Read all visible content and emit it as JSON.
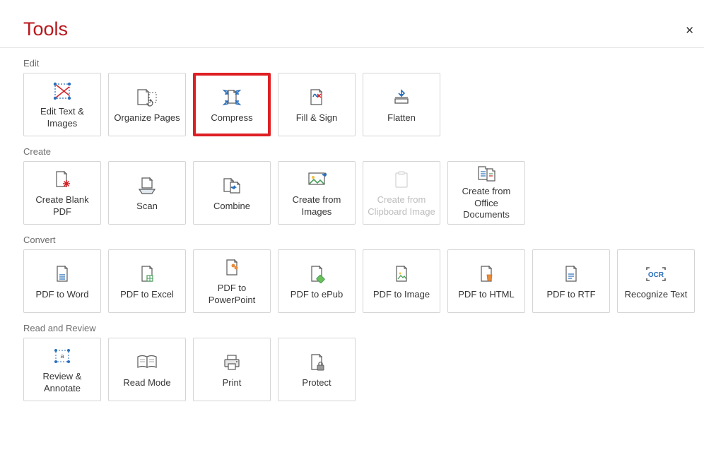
{
  "title": "Tools",
  "close_label": "Close",
  "sections": {
    "edit": {
      "label": "Edit",
      "tools": [
        {
          "id": "edit-text-images",
          "label": "Edit Text & Images"
        },
        {
          "id": "organize-pages",
          "label": "Organize Pages"
        },
        {
          "id": "compress",
          "label": "Compress",
          "highlighted": true
        },
        {
          "id": "fill-sign",
          "label": "Fill & Sign"
        },
        {
          "id": "flatten",
          "label": "Flatten"
        }
      ]
    },
    "create": {
      "label": "Create",
      "tools": [
        {
          "id": "create-blank-pdf",
          "label": "Create\nBlank PDF"
        },
        {
          "id": "scan",
          "label": "Scan"
        },
        {
          "id": "combine",
          "label": "Combine"
        },
        {
          "id": "create-from-images",
          "label": "Create from Images"
        },
        {
          "id": "create-from-clipboard",
          "label": "Create from Clipboard Image",
          "disabled": true
        },
        {
          "id": "create-from-office",
          "label": "Create from Office Documents"
        }
      ]
    },
    "convert": {
      "label": "Convert",
      "tools": [
        {
          "id": "pdf-to-word",
          "label": "PDF to Word"
        },
        {
          "id": "pdf-to-excel",
          "label": "PDF to Excel"
        },
        {
          "id": "pdf-to-powerpoint",
          "label": "PDF to PowerPoint"
        },
        {
          "id": "pdf-to-epub",
          "label": "PDF to ePub"
        },
        {
          "id": "pdf-to-image",
          "label": "PDF to Image"
        },
        {
          "id": "pdf-to-html",
          "label": "PDF to HTML"
        },
        {
          "id": "pdf-to-rtf",
          "label": "PDF to RTF"
        },
        {
          "id": "recognize-text",
          "label": "Recognize Text"
        }
      ]
    },
    "review": {
      "label": "Read and Review",
      "tools": [
        {
          "id": "review-annotate",
          "label": "Review & Annotate"
        },
        {
          "id": "read-mode",
          "label": "Read Mode"
        },
        {
          "id": "print",
          "label": "Print"
        },
        {
          "id": "protect",
          "label": "Protect"
        }
      ]
    }
  }
}
